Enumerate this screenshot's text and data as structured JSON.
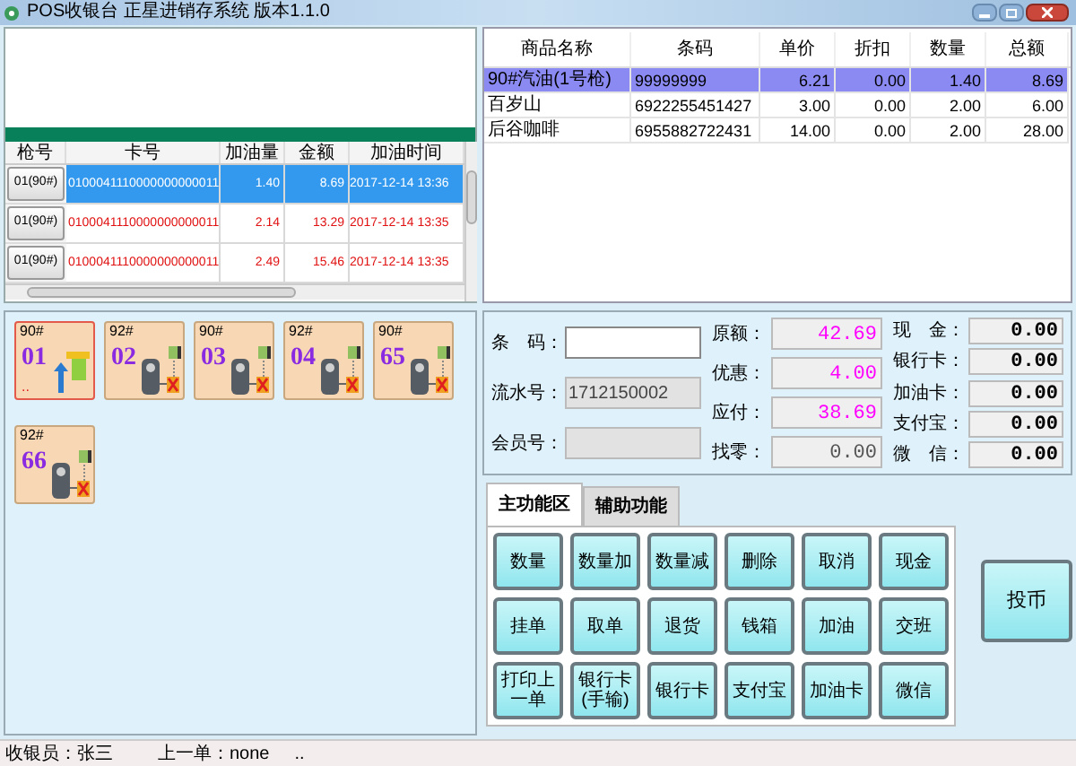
{
  "window": {
    "title": "POS收银台 正星进销存系统 版本1.1.0"
  },
  "fuel_table": {
    "columns": [
      "枪号",
      "卡号",
      "加油量",
      "金额",
      "加油时间"
    ],
    "rows": [
      {
        "pump": "01(90#)",
        "card": "0100041110000000000011",
        "volume": "1.40",
        "amount": "8.69",
        "time": "2017-12-14 13:36",
        "selected": true
      },
      {
        "pump": "01(90#)",
        "card": "0100041110000000000011",
        "volume": "2.14",
        "amount": "13.29",
        "time": "2017-12-14 13:35",
        "selected": false
      },
      {
        "pump": "01(90#)",
        "card": "0100041110000000000011",
        "volume": "2.49",
        "amount": "15.46",
        "time": "2017-12-14 13:35",
        "selected": false
      }
    ]
  },
  "pumps": [
    {
      "grade": "90#",
      "number": "01",
      "kind": "fueling",
      "note": "..",
      "selected": true
    },
    {
      "grade": "92#",
      "number": "02",
      "kind": "offline",
      "selected": false
    },
    {
      "grade": "90#",
      "number": "03",
      "kind": "offline",
      "selected": false
    },
    {
      "grade": "92#",
      "number": "04",
      "kind": "offline",
      "selected": false
    },
    {
      "grade": "90#",
      "number": "65",
      "kind": "offline",
      "selected": false
    },
    {
      "grade": "92#",
      "number": "66",
      "kind": "offline",
      "selected": false
    }
  ],
  "products": {
    "columns": [
      "商品名称",
      "条码",
      "单价",
      "折扣",
      "数量",
      "总额"
    ],
    "rows": [
      {
        "name": "90#汽油(1号枪)",
        "barcode": "99999999",
        "price": "6.21",
        "discount": "0.00",
        "qty": "1.40",
        "total": "8.69",
        "selected": true
      },
      {
        "name": "百岁山",
        "barcode": "6922255451427",
        "price": "3.00",
        "discount": "0.00",
        "qty": "2.00",
        "total": "6.00",
        "selected": false
      },
      {
        "name": "后谷咖啡",
        "barcode": "6955882722431",
        "price": "14.00",
        "discount": "0.00",
        "qty": "2.00",
        "total": "28.00",
        "selected": false
      }
    ]
  },
  "order_fields": [
    {
      "label": "条　码：",
      "disabled": false
    },
    {
      "label": "流水号：",
      "value": "1712150002",
      "disabled": true
    },
    {
      "label": "会员号：",
      "disabled": true
    }
  ],
  "amounts": [
    {
      "label": "原额：",
      "value": "42.69",
      "highlight": true
    },
    {
      "label": "优惠：",
      "value": "4.00",
      "highlight": true
    },
    {
      "label": "应付：",
      "value": "38.69",
      "highlight": true
    },
    {
      "label": "找零：",
      "value": "0.00",
      "highlight": false
    }
  ],
  "payments": [
    {
      "label": "现　金：",
      "value": "0.00"
    },
    {
      "label": "银行卡：",
      "value": "0.00"
    },
    {
      "label": "加油卡：",
      "value": "0.00"
    },
    {
      "label": "支付宝：",
      "value": "0.00"
    },
    {
      "label": "微　信：",
      "value": "0.00"
    }
  ],
  "tabs": [
    {
      "label": "主功能区",
      "selected": true
    },
    {
      "label": "辅助功能",
      "selected": false
    }
  ],
  "buttons": [
    "数量",
    "数量加",
    "数量减",
    "删除",
    "取消",
    "现金",
    "挂单",
    "取单",
    "退货",
    "钱箱",
    "加油",
    "交班",
    "打印上一单",
    "银行卡(手输)",
    "银行卡",
    "支付宝",
    "加油卡",
    "微信"
  ],
  "side_button": "投币",
  "status_bar": [
    {
      "label": "收银员：",
      "value": "张三"
    },
    {
      "label": "上一单：",
      "value": "none"
    }
  ],
  "status_extra": ".."
}
